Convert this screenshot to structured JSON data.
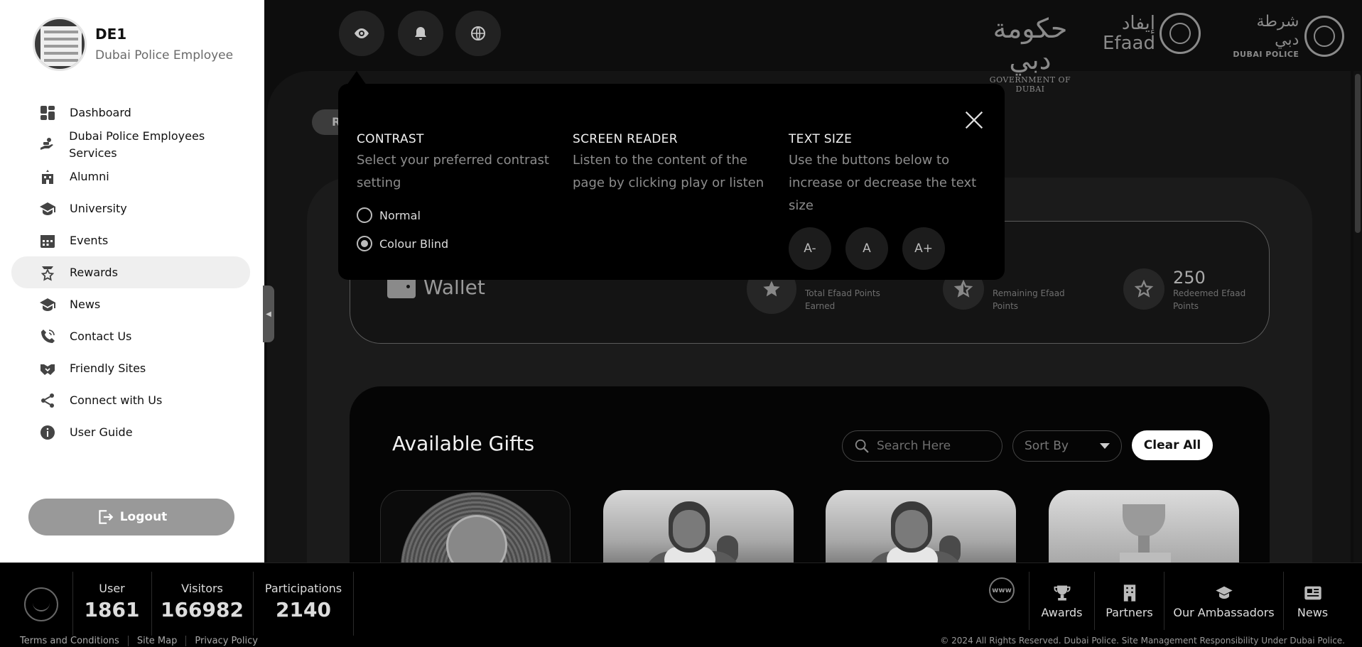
{
  "user": {
    "name": "DE1",
    "role": "Dubai Police Employee"
  },
  "sidebar": {
    "items": [
      {
        "label": "Dashboard",
        "icon": "dashboard-icon"
      },
      {
        "label": "Dubai Police Employees Services",
        "icon": "hand-service-icon"
      },
      {
        "label": "Alumni",
        "icon": "building-icon"
      },
      {
        "label": "University",
        "icon": "graduation-cap-icon"
      },
      {
        "label": "Events",
        "icon": "calendar-icon"
      },
      {
        "label": "Rewards",
        "icon": "reward-star-icon",
        "active": true
      },
      {
        "label": "News",
        "icon": "news-cap-icon"
      },
      {
        "label": "Contact Us",
        "icon": "phone-icon"
      },
      {
        "label": "Friendly Sites",
        "icon": "handshake-icon"
      },
      {
        "label": "Connect with Us",
        "icon": "share-icon"
      },
      {
        "label": "User Guide",
        "icon": "info-icon"
      }
    ],
    "logout_label": "Logout"
  },
  "topbar": {
    "buttons": [
      "eye-icon",
      "bell-icon",
      "globe-icon"
    ],
    "logos": {
      "government": {
        "arabic": "حكومة دبي",
        "english": "GOVERNMENT OF DUBAI"
      },
      "efaad": {
        "arabic": "إيفاد",
        "english": "Efaad"
      },
      "dubai_police": {
        "arabic": "شرطة دبي",
        "english": "DUBAI POLICE"
      }
    }
  },
  "accessibility": {
    "contrast": {
      "title": "CONTRAST",
      "description": "Select your preferred contrast setting",
      "options": [
        {
          "label": "Normal",
          "selected": false
        },
        {
          "label": "Colour Blind",
          "selected": true
        }
      ]
    },
    "screen_reader": {
      "title": "SCREEN READER",
      "description": "Listen to the content of the page by clicking play or listen"
    },
    "text_size": {
      "title": "TEXT SIZE",
      "description": "Use the buttons below to increase or decrease the text size",
      "buttons": [
        "A-",
        "A",
        "A+"
      ]
    }
  },
  "pill_partial": "R",
  "wallet": {
    "title": "Wallet",
    "stats": [
      {
        "value": "",
        "label": "Total Efaad Points Earned",
        "icon": "star-filled-icon"
      },
      {
        "value": "",
        "label": "Remaining Efaad Points",
        "icon": "star-half-icon"
      },
      {
        "value": "250",
        "label": "Redeemed Efaad Points",
        "icon": "star-outline-icon"
      }
    ]
  },
  "gifts": {
    "title": "Available Gifts",
    "search_placeholder": "Search Here",
    "sort_label": "Sort By",
    "clear_label": "Clear All",
    "cards": [
      "medal-image",
      "person-photo",
      "person-photo",
      "trophy-image"
    ]
  },
  "footer": {
    "stats": [
      {
        "label": "User",
        "value": "1861"
      },
      {
        "label": "Visitors",
        "value": "166982"
      },
      {
        "label": "Participations",
        "value": "2140"
      }
    ],
    "links": [
      "Terms and Conditions",
      "Site Map",
      "Privacy Policy"
    ],
    "nav": [
      {
        "label": "Awards",
        "icon": "trophy-icon"
      },
      {
        "label": "Partners",
        "icon": "building-icon"
      },
      {
        "label": "Our Ambassadors",
        "icon": "ambassador-icon"
      },
      {
        "label": "News",
        "icon": "newspaper-icon"
      }
    ],
    "www_label": "www",
    "copyright": "© 2024 All Rights Reserved. Dubai Police. Site Management Responsibility Under Dubai Police."
  }
}
